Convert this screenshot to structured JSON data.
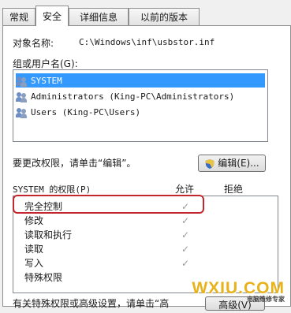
{
  "tabs": [
    "常规",
    "安全",
    "详细信息",
    "以前的版本"
  ],
  "object_name": {
    "label": "对象名称:",
    "value": "C:\\Windows\\inf\\usbstor.inf"
  },
  "group_label": "组或用户名(G):",
  "users": [
    {
      "name": "SYSTEM",
      "selected": true
    },
    {
      "name": "Administrators (King-PC\\Administrators)",
      "selected": false
    },
    {
      "name": "Users (King-PC\\Users)",
      "selected": false
    }
  ],
  "edit_hint": "要更改权限，请单击“编辑”。",
  "edit_button": "编辑(E)...",
  "permissions": {
    "header": "SYSTEM 的权限(P)",
    "allow": "允许",
    "deny": "拒绝",
    "rows": [
      {
        "name": "完全控制",
        "allow": true
      },
      {
        "name": "修改",
        "allow": true
      },
      {
        "name": "读取和执行",
        "allow": true
      },
      {
        "name": "读取",
        "allow": true
      },
      {
        "name": "写入",
        "allow": true
      },
      {
        "name": "特殊权限",
        "allow": false
      }
    ],
    "check_glyph": "✓"
  },
  "footer_hint": "有关特殊权限或高级设置，请单击“高",
  "advanced_button": "高级(V)",
  "watermark": {
    "main": "WXIU.COM",
    "sub": "电脑维修专家"
  },
  "colors": {
    "selection": "#3399ff",
    "highlight_border": "#c4262e",
    "watermark": "#e8b21a"
  }
}
